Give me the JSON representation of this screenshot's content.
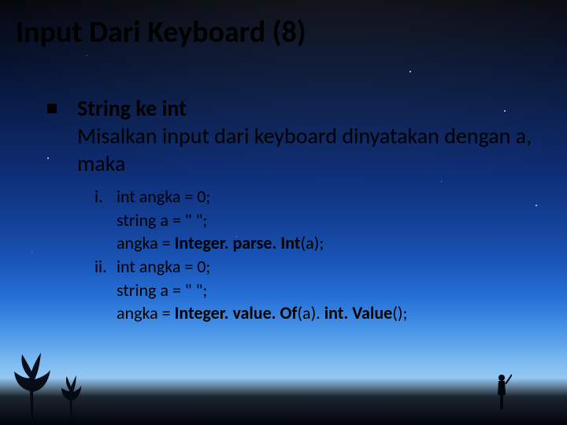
{
  "title": "Input Dari Keyboard (8)",
  "lead": {
    "heading": "String ke int",
    "line2": "Misalkan input dari keyboard dinyatakan dengan a, maka"
  },
  "items": [
    {
      "num": "i.",
      "l1": "int angka = 0;",
      "l2": "string a = \" \";",
      "l3a": "angka = ",
      "l3b": "Integer. parse. Int",
      "l3c": "(a);"
    },
    {
      "num": "ii.",
      "l1": "int angka = 0;",
      "l2": "string a = \" \";",
      "l3a": "angka = ",
      "l3b": "Integer. value. Of",
      "l3c": "(a). ",
      "l3d": "int. Value",
      "l3e": "();"
    }
  ]
}
